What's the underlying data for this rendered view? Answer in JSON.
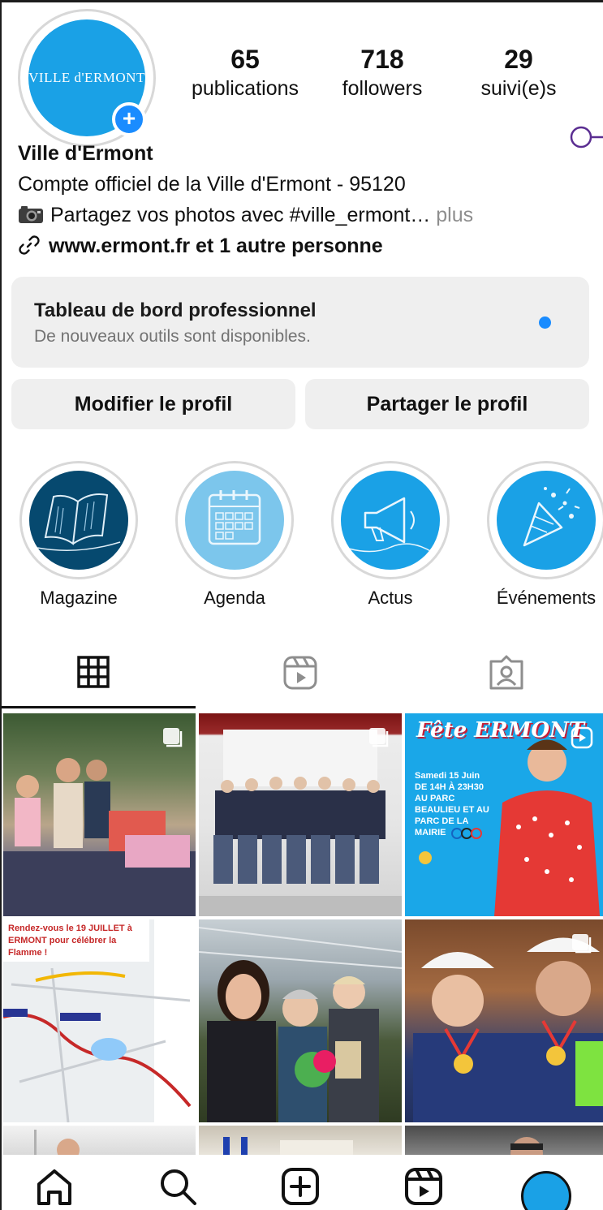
{
  "profile": {
    "avatar_text": "VILLE d'ERMONT",
    "name": "Ville d'Ermont",
    "bio_line1": "Compte officiel de la Ville d'Ermont - 95120",
    "bio_line2": "Partagez vos photos avec #ville_ermont…",
    "bio_more": " plus",
    "link_text": "www.ermont.fr et 1 autre personne"
  },
  "stats": [
    {
      "value": "65",
      "label": "publications"
    },
    {
      "value": "718",
      "label": "followers"
    },
    {
      "value": "29",
      "label": "suivi(e)s"
    }
  ],
  "dashboard": {
    "title": "Tableau de bord professionnel",
    "subtitle": "De nouveaux outils sont disponibles."
  },
  "buttons": {
    "edit": "Modifier le profil",
    "share": "Partager le profil"
  },
  "highlights": [
    {
      "label": "Magazine",
      "icon": "magazine-icon"
    },
    {
      "label": "Agenda",
      "icon": "calendar-icon"
    },
    {
      "label": "Actus",
      "icon": "megaphone-icon"
    },
    {
      "label": "Événements",
      "icon": "party-popper-icon"
    }
  ],
  "tabs": [
    {
      "icon": "grid-icon",
      "active": true
    },
    {
      "icon": "reels-icon",
      "active": false
    },
    {
      "icon": "tagged-icon",
      "active": false
    }
  ],
  "posts": [
    {
      "poster_text": ""
    },
    {
      "poster_text": ""
    },
    {
      "poster_text": "Samedi 15 Juin DE 14H À 23H30 AU PARC BEAULIEU ET AU PARC DE LA MAIRIE",
      "title_text": "Fête ERMONT"
    },
    {
      "poster_text": "Rendez-vous le 19 JUILLET à ERMONT pour célébrer la Flamme !"
    },
    {
      "poster_text": ""
    },
    {
      "poster_text": ""
    }
  ],
  "nav": [
    "home-icon",
    "search-icon",
    "create-icon",
    "reels-icon",
    "profile-icon"
  ],
  "colors": {
    "accent": "#1a8cff",
    "brand_blue": "#1aa1e6",
    "muted": "#737373"
  }
}
